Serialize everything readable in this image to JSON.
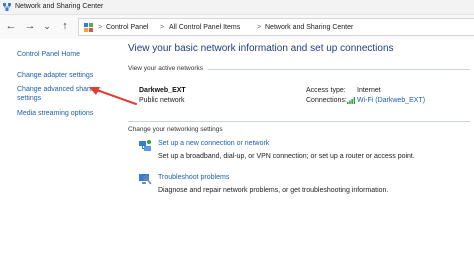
{
  "window": {
    "title": "Network and Sharing Center"
  },
  "nav": {
    "back": "←",
    "forward": "→",
    "dropdown": "⌄",
    "up": "↑",
    "breadcrumb": [
      "Control Panel",
      "All Control Panel Items",
      "Network and Sharing Center"
    ],
    "separator": ">"
  },
  "sidebar": {
    "items": [
      {
        "label": "Control Panel Home"
      },
      {
        "label": "Change adapter settings"
      },
      {
        "label": "Change advanced sharing settings"
      },
      {
        "label": "Media streaming options"
      }
    ]
  },
  "main": {
    "heading": "View your basic network information and set up connections",
    "active_networks_label": "View your active networks",
    "network": {
      "name": "Darkweb_EXT",
      "category": "Public network",
      "access_type_label": "Access type:",
      "access_type_value": "Internet",
      "connections_label": "Connections:",
      "connections_value": "Wi-Fi (Darkweb_EXT)"
    },
    "change_settings_label": "Change your networking settings",
    "tasks": [
      {
        "link": "Set up a new connection or network",
        "desc": "Set up a broadband, dial-up, or VPN connection; or set up a router or access point."
      },
      {
        "link": "Troubleshoot problems",
        "desc": "Diagnose and repair network problems, or get troubleshooting information."
      }
    ]
  },
  "colors": {
    "link": "#1f5fa8",
    "heading": "#1f3e7a",
    "arrow": "#e03c31",
    "wifi": "#2e9e3e"
  }
}
